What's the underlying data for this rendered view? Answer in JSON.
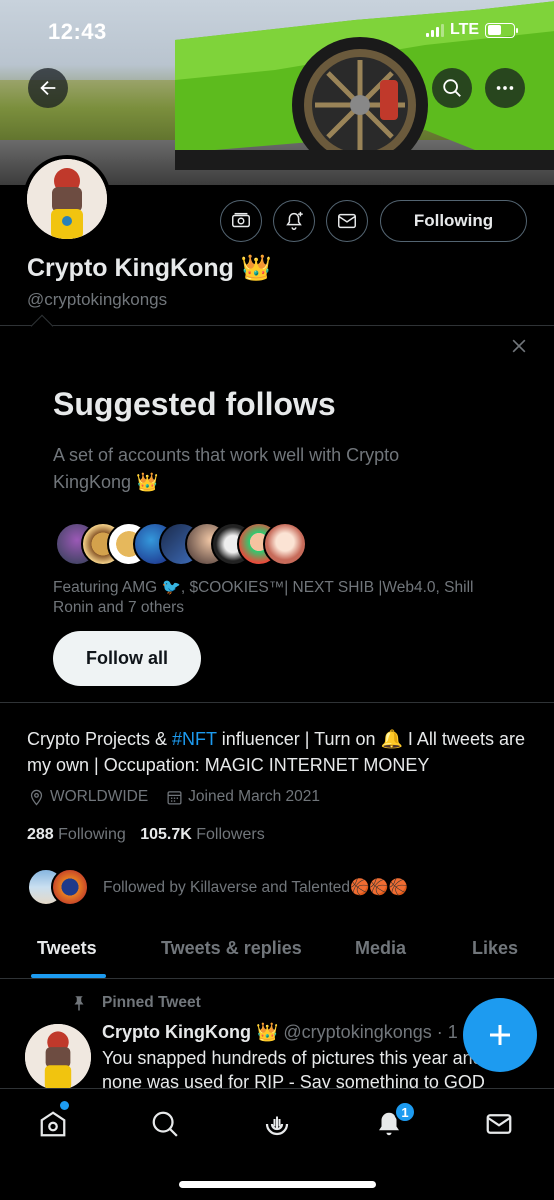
{
  "status_bar": {
    "time": "12:43",
    "network": "LTE",
    "battery_level": 0.55
  },
  "profile": {
    "name": "Crypto KingKong 👑",
    "handle": "@cryptokingkongs",
    "following_label": "Following",
    "bio_prefix": "Crypto Projects & ",
    "bio_hashtag": "#NFT",
    "bio_suffix": " influencer | Turn on 🔔 I All tweets are my own | Occupation: MAGIC INTERNET MONEY",
    "location": "WORLDWIDE",
    "joined": "Joined March 2021",
    "following_count": "288",
    "following_label_text": "Following",
    "followers_count": "105.7K",
    "followers_label_text": "Followers",
    "followed_by": "Followed by Killaverse and Talented🏀🏀🏀"
  },
  "suggested": {
    "title": "Suggested follows",
    "description": "A set of accounts that work well with Crypto KingKong 👑",
    "featuring": "Featuring AMG 🐦, $COOKIES™| NEXT SHIB |Web4.0, Shill Ronin and 7 others",
    "follow_all_label": "Follow all"
  },
  "tabs": [
    {
      "label": "Tweets",
      "active": true
    },
    {
      "label": "Tweets & replies",
      "active": false
    },
    {
      "label": "Media",
      "active": false
    },
    {
      "label": "Likes",
      "active": false
    }
  ],
  "tweet": {
    "pinned_label": "Pinned Tweet",
    "author": "Crypto KingKong 👑",
    "handle_time": "@cryptokingkongs · 1",
    "text": "You snapped hundreds of pictures this year and none was used for RIP - Say something to GOD"
  },
  "nav": {
    "notifications_badge": "1"
  },
  "colors": {
    "accent": "#1d9bf0",
    "background": "#000000",
    "muted": "#71767b"
  },
  "icons": [
    "back-arrow-icon",
    "search-icon",
    "more-icon",
    "tip-icon",
    "notify-bell-icon",
    "message-icon",
    "location-icon",
    "calendar-icon",
    "pin-icon",
    "compose-plus-icon",
    "home-icon",
    "spaces-icon",
    "bell-icon",
    "mail-icon"
  ]
}
